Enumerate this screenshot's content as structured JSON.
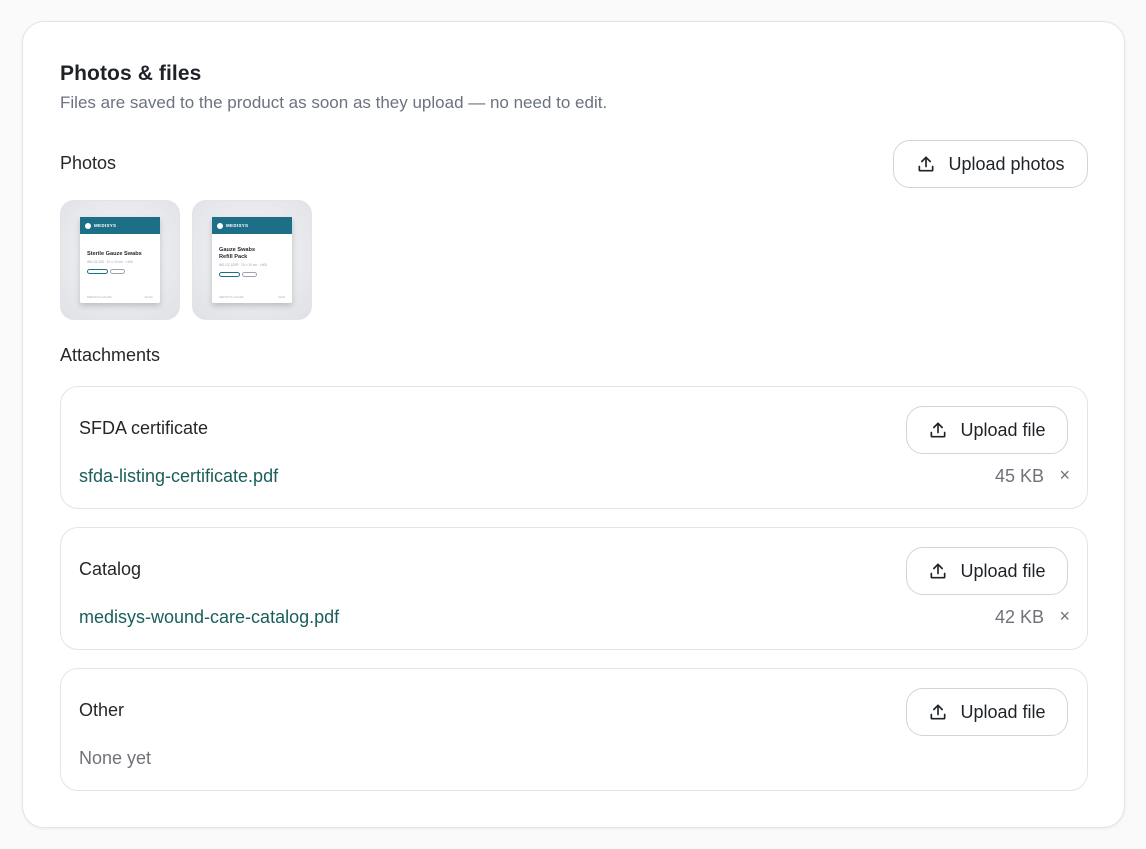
{
  "panel": {
    "title": "Photos & files",
    "subtitle": "Files are saved to the product as soon as they upload — no need to edit."
  },
  "photos": {
    "label": "Photos",
    "upload_label": "Upload photos",
    "upload_icon": "upload-icon",
    "items": [
      {
        "brand": "MEDISYS",
        "name": "Sterile Gauze Swabs",
        "spec": "WS-GZ-100 · 10 × 10 cm · ×100",
        "footer_left": "MEDISYS GAUZE",
        "footer_right": "Sterile"
      },
      {
        "brand": "MEDISYS",
        "name": "Gauze Swabs Refill Pack",
        "spec": "WS-GZ-100R · 10 × 10 cm · ×400",
        "footer_left": "MEDISYS GAUZE",
        "footer_right": "Refill"
      }
    ]
  },
  "attachments": {
    "label": "Attachments",
    "items": [
      {
        "title": "SFDA certificate",
        "upload_label": "Upload file",
        "file_name": "sfda-listing-certificate.pdf",
        "file_size": "45 KB",
        "remove_label": "×"
      },
      {
        "title": "Catalog",
        "upload_label": "Upload file",
        "file_name": "medisys-wound-care-catalog.pdf",
        "file_size": "42 KB",
        "remove_label": "×"
      },
      {
        "title": "Other",
        "upload_label": "Upload file",
        "empty_text": "None yet"
      }
    ]
  },
  "colors": {
    "link": "#1a5e5a",
    "box_header": "#1c6f87",
    "muted": "#71717a"
  }
}
